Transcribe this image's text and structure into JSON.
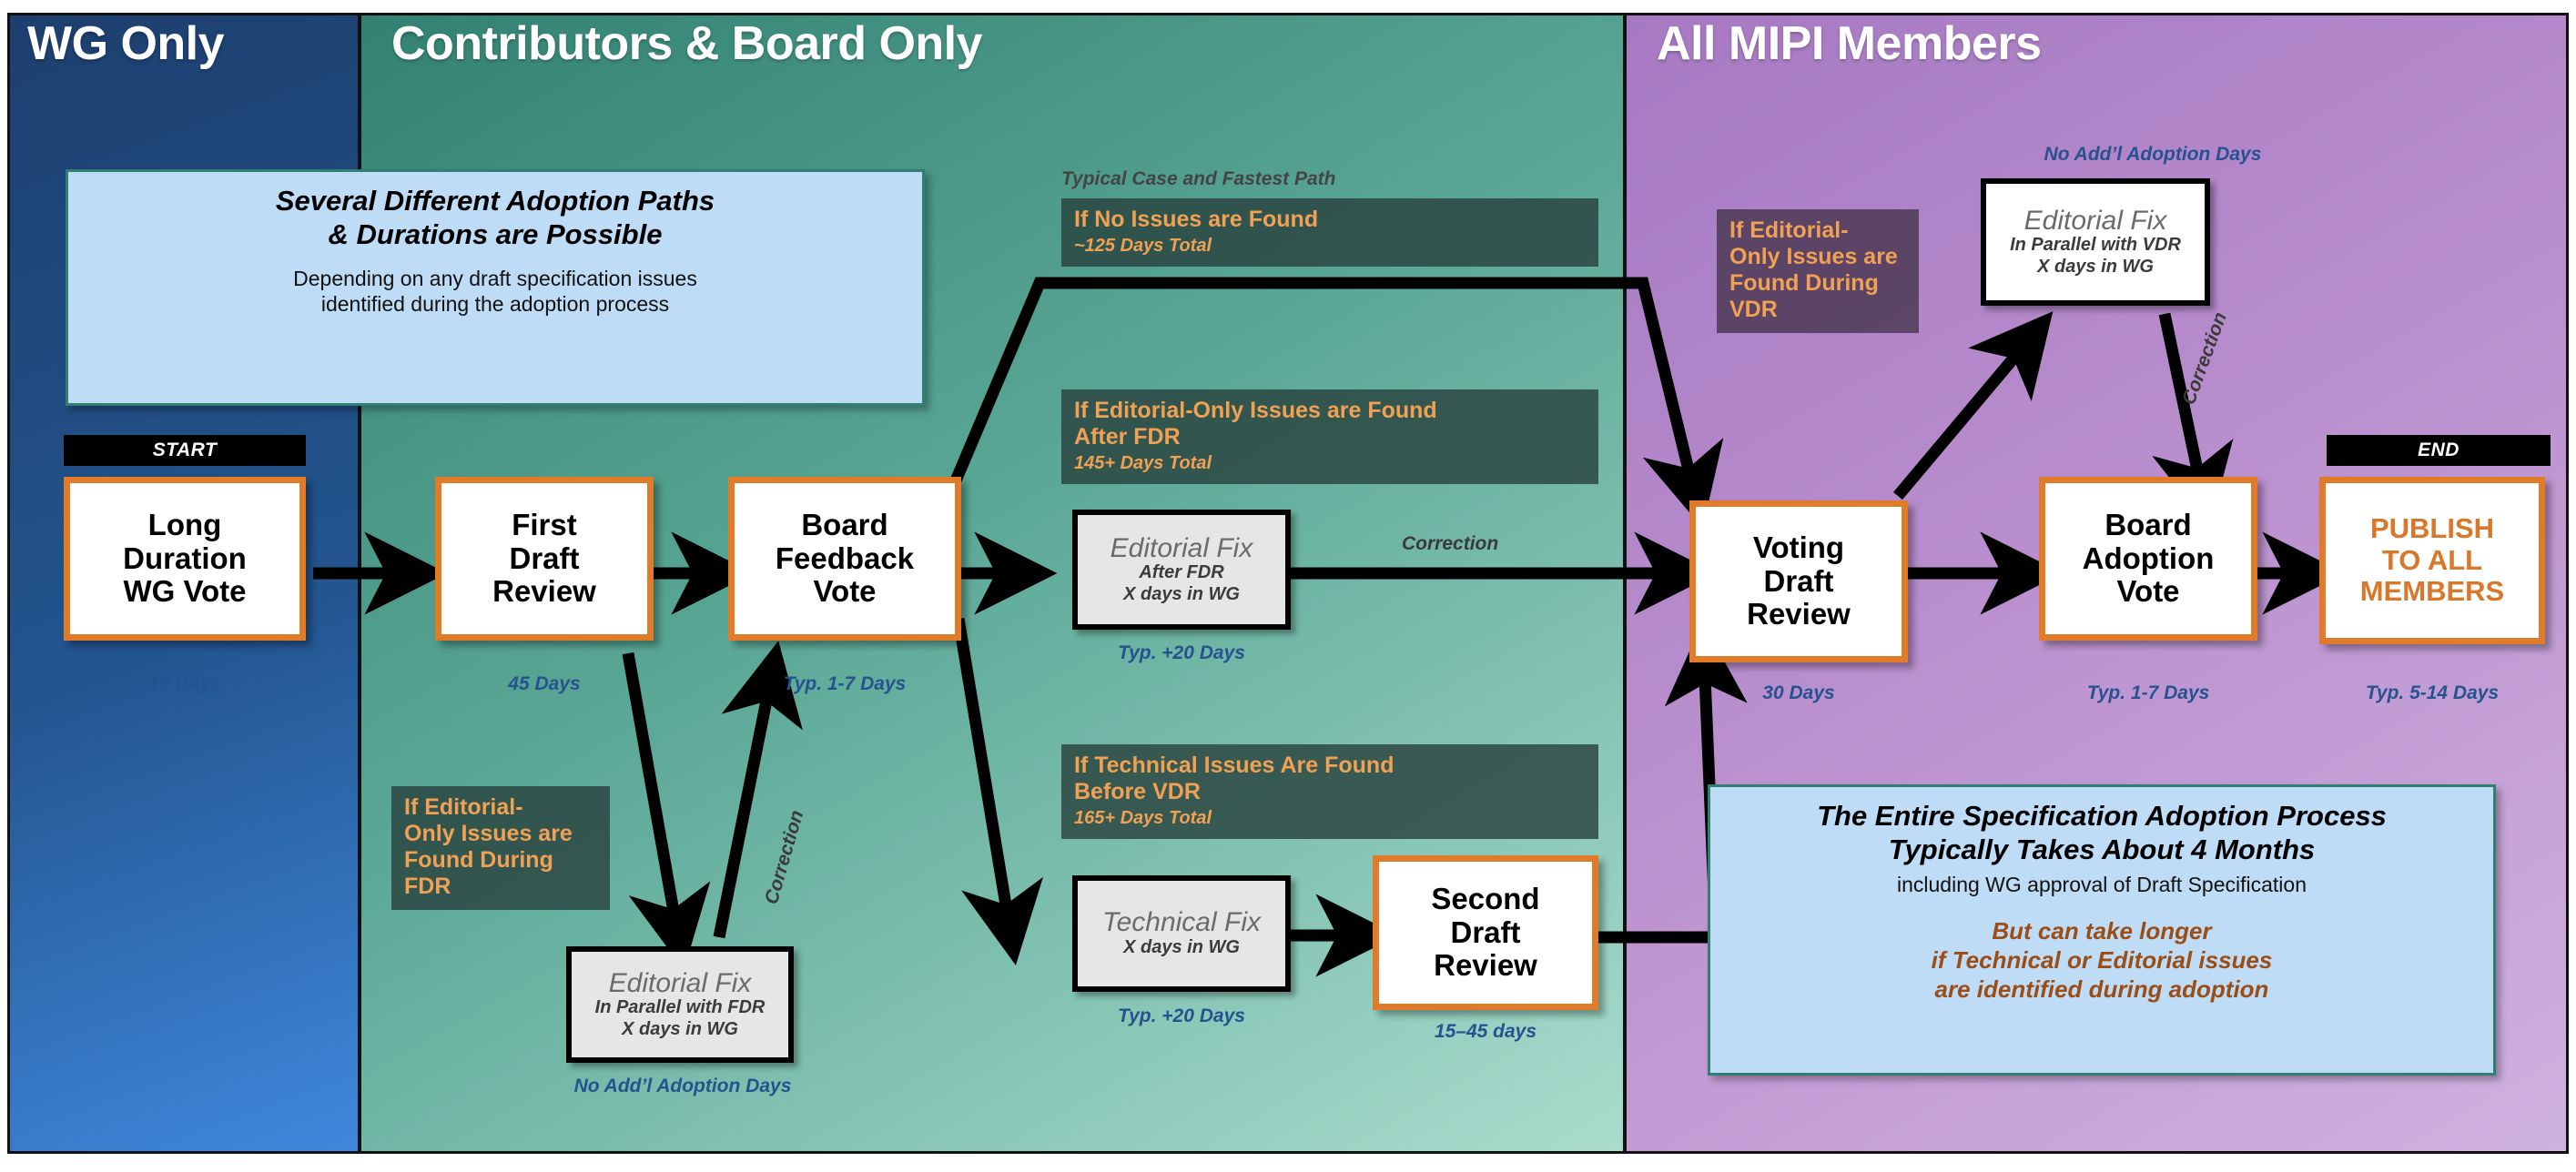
{
  "bands": {
    "wg": "WG Only",
    "contributors": "Contributors & Board Only",
    "all_members": "All MIPI Members"
  },
  "callouts": {
    "top_left": {
      "head_line1": "Several Different Adoption Paths",
      "head_line2": "& Durations are Possible",
      "sub_line1": "Depending on any draft specification issues",
      "sub_line2": "identified during the adoption process"
    },
    "bottom_right": {
      "head_line1": "The Entire Specification Adoption Process",
      "head_line2": "Typically Takes About 4 Months",
      "sub_line1": "including WG approval of Draft Specification",
      "warn_line1": "But can take longer",
      "warn_line2": "if Technical or Editorial issues",
      "warn_line3": "are identified during adoption"
    }
  },
  "caps": {
    "start": "START",
    "end": "END"
  },
  "process_boxes": [
    {
      "id": "long-duration-wg-vote",
      "lines": [
        "Long",
        "Duration",
        "WG Vote"
      ],
      "duration": "10 Days"
    },
    {
      "id": "first-draft-review",
      "lines": [
        "First",
        "Draft",
        "Review"
      ],
      "duration": "45 Days"
    },
    {
      "id": "board-feedback-vote",
      "lines": [
        "Board",
        "Feedback",
        "Vote"
      ],
      "duration": "Typ. 1-7 Days"
    },
    {
      "id": "second-draft-review",
      "lines": [
        "Second",
        "Draft",
        "Review"
      ],
      "duration": "15–45 days"
    },
    {
      "id": "voting-draft-review",
      "lines": [
        "Voting",
        "Draft",
        "Review"
      ],
      "duration": "30 Days"
    },
    {
      "id": "board-adoption-vote",
      "lines": [
        "Board",
        "Adoption",
        "Vote"
      ],
      "duration": "Typ. 1-7 Days"
    },
    {
      "id": "publish-to-all-members",
      "lines": [
        "PUBLISH",
        "TO ALL",
        "MEMBERS"
      ],
      "duration": "Typ. 5-14 Days"
    }
  ],
  "fix_boxes": [
    {
      "id": "editorial-fix-parallel-fdr",
      "title": "Editorial Fix",
      "line1": "In Parallel with FDR",
      "line2": "X days in WG",
      "duration": "No Add’l Adoption Days"
    },
    {
      "id": "editorial-fix-after-fdr",
      "title": "Editorial Fix",
      "line1": "After FDR",
      "line2": "X days in WG",
      "duration": "Typ. +20 Days"
    },
    {
      "id": "technical-fix",
      "title": "Technical Fix",
      "line1": "X days in WG",
      "line2": "",
      "duration": "Typ. +20 Days"
    },
    {
      "id": "editorial-fix-parallel-vdr",
      "title": "Editorial Fix",
      "line1": "In Parallel with VDR",
      "line2": "X days in WG",
      "duration": "No Add’l Adoption Days"
    }
  ],
  "notes": {
    "fastest_path_caption": "Typical Case and Fastest Path",
    "no_issues": {
      "head": "If No Issues are Found",
      "sub": "~125 Days Total"
    },
    "editorial_after_fdr": {
      "head_line1": "If Editorial-Only Issues are Found",
      "head_line2": "After FDR",
      "sub": "145+ Days Total"
    },
    "technical_before_vdr": {
      "head_line1": "If Technical Issues Are Found",
      "head_line2": "Before VDR",
      "sub": "165+ Days Total"
    },
    "editorial_during_fdr": {
      "head_line1": "If Editorial-",
      "head_line2": "Only Issues are",
      "head_line3": "Found During",
      "head_line4": "FDR"
    },
    "editorial_during_vdr": {
      "head_line1": "If Editorial-",
      "head_line2": "Only Issues are",
      "head_line3": "Found During",
      "head_line4": "VDR"
    }
  },
  "edge_labels": {
    "correction_fdr": "Correction",
    "correction_after_fdr": "Correction",
    "correction_vdr": "Correction"
  },
  "colors": {
    "band_wg": "#23558f",
    "band_contributors": "#5aa795",
    "band_all": "#b98ecd",
    "accent_orange": "#e07b2a",
    "note_orange_text": "#f0a154",
    "duration_blue": "#26528f",
    "callout_blue": "#bfdcf7",
    "warn_brown": "#9a4d15"
  }
}
